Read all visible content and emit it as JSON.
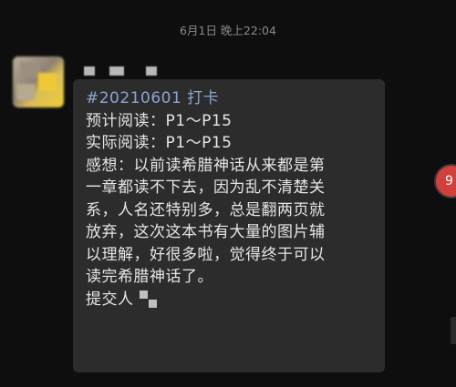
{
  "chat": {
    "timestamp": "6月1日 晚上22:04",
    "message": {
      "hashtag": "#20210601 打卡",
      "lines": [
        "预计阅读：P1～P15",
        "实际阅读：P1～P15",
        "感想：以前读希腊神话从来都是第",
        "一章都读不下去，因为乱不清楚关",
        "系，人名还特别多，总是翻两页就",
        "放弃，这次这本书有大量的图片辅",
        "以理解，好很多啦，觉得终于可以",
        "读完希腊神话了。"
      ],
      "submitter_label": "提交人"
    }
  },
  "unread_badge": {
    "count": "9"
  },
  "colors": {
    "background": "#0e0e0e",
    "bubble": "#2c2c2c",
    "text": "#e6e6e6",
    "hashtag": "#8aa6d4",
    "badge": "#d1403c"
  }
}
